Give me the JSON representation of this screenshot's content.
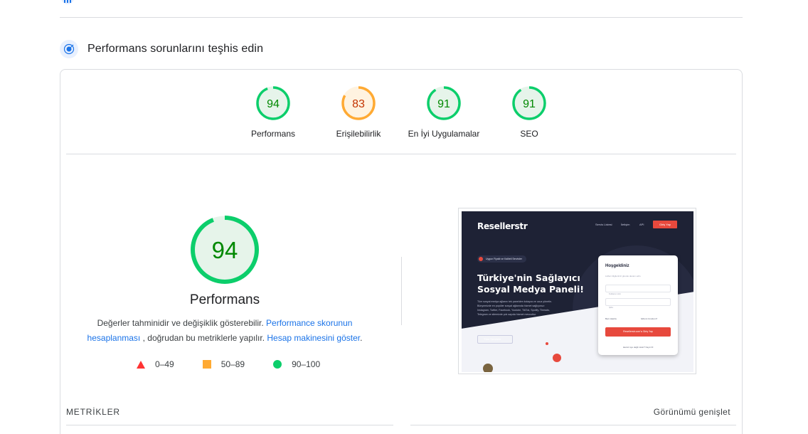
{
  "top_section": {
    "title": "",
    "icon": "speed-gauge-icon"
  },
  "diagnose": {
    "title": "Performans sorunlarını teşhis edin",
    "icon": "diagnose-target-icon"
  },
  "categories": [
    {
      "score": 94,
      "label": "Performans",
      "status": "good"
    },
    {
      "score": 83,
      "label": "Erişilebilirlik",
      "status": "average"
    },
    {
      "score": 91,
      "label": "En İyi Uygulamalar",
      "status": "good"
    },
    {
      "score": 91,
      "label": "SEO",
      "status": "good"
    }
  ],
  "main_gauge": {
    "score": 94,
    "label": "Performans",
    "desc_prefix": "Değerler tahminidir ve değişiklik gösterebilir.",
    "link_score": "Performance skorunun hesaplanması",
    "desc_middle": ", doğrudan bu metriklerle yapılır.",
    "link_calc": "Hesap makinesini göster",
    "desc_suffix": "."
  },
  "legend": [
    {
      "range": "0–49",
      "shape": "triangle",
      "color": "#ff3333"
    },
    {
      "range": "50–89",
      "shape": "square",
      "color": "#ffaa33"
    },
    {
      "range": "90–100",
      "shape": "circle",
      "color": "#0cce6b"
    }
  ],
  "colors": {
    "good_stroke": "#0cce6b",
    "good_fill": "#e6f4ea",
    "good_text": "#008800",
    "average_stroke": "#ffaa33",
    "average_fill": "#fff3e0",
    "average_text": "#c33300",
    "link": "#1a73e8"
  },
  "screenshot": {
    "logo": "Resellerstr",
    "nav": [
      "Servis Listesi",
      "İletişim",
      "API"
    ],
    "nav_button": "Giriş Yap",
    "pill": "Uygun Fiyatlı ve Kaliteli Servisler",
    "headline": "Türkiye'nin Sağlayıcı Sosyal Medya Paneli!",
    "paragraph": "Tüm sosyal medya ağlarını tek panelden kolayca ve ucuz yönetin. Bünyemizde en popüler sosyal ağlarında hizmet sağlıyoruz: Instagram, Twitter, Facebook, Youtube, TikTok, Spotify, Threads, Telegram ve sitemizde çok sayıda hizmet mevcuttur.",
    "cta": "Tüm Servisler",
    "login_title": "Hoşgeldiniz",
    "login_sub": "Lütfen bilgilerinizi girerek devam edin.",
    "login_user": "Kullanıcı Adı",
    "login_pass": "Şifre",
    "remember": "Beni Hatırla",
    "forgot": "Şifremi Unuttum?",
    "login_btn": "Resellerstr.com'a Giriş Yap",
    "login_foot": "Henüz üye değil misin? Kayıt Ol"
  },
  "metrics": {
    "label": "METRİKLER",
    "expand": "Görünümü genişlet"
  }
}
